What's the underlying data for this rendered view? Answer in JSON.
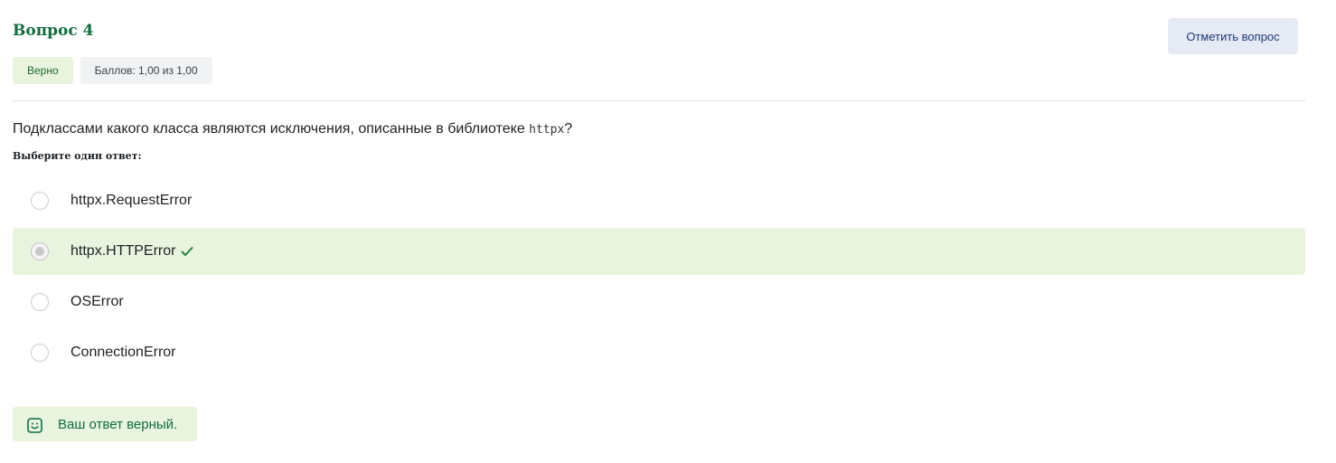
{
  "question": {
    "title": "Вопрос 4",
    "flag_label": "Отметить вопрос",
    "status_badge": "Верно",
    "grade_badge": "Баллов: 1,00 из 1,00",
    "text_before": "Подклассами какого класса являются исключения, описанные в библиотеке ",
    "text_code": "httpx",
    "text_after": "?",
    "prompt": "Выберите один ответ:"
  },
  "answers": [
    {
      "label": "httpx.RequestError",
      "selected": false,
      "correct": false
    },
    {
      "label": "httpx.HTTPError",
      "selected": true,
      "correct": true
    },
    {
      "label": "OSError",
      "selected": false,
      "correct": false
    },
    {
      "label": "ConnectionError",
      "selected": false,
      "correct": false
    }
  ],
  "feedback": {
    "text": "Ваш ответ верный.",
    "icon": "smile-icon"
  },
  "colors": {
    "accent_green": "#0f6d3e",
    "correct_bg": "#e8f4de",
    "flag_bg": "#e6eaf4",
    "flag_text": "#1f3a78"
  }
}
